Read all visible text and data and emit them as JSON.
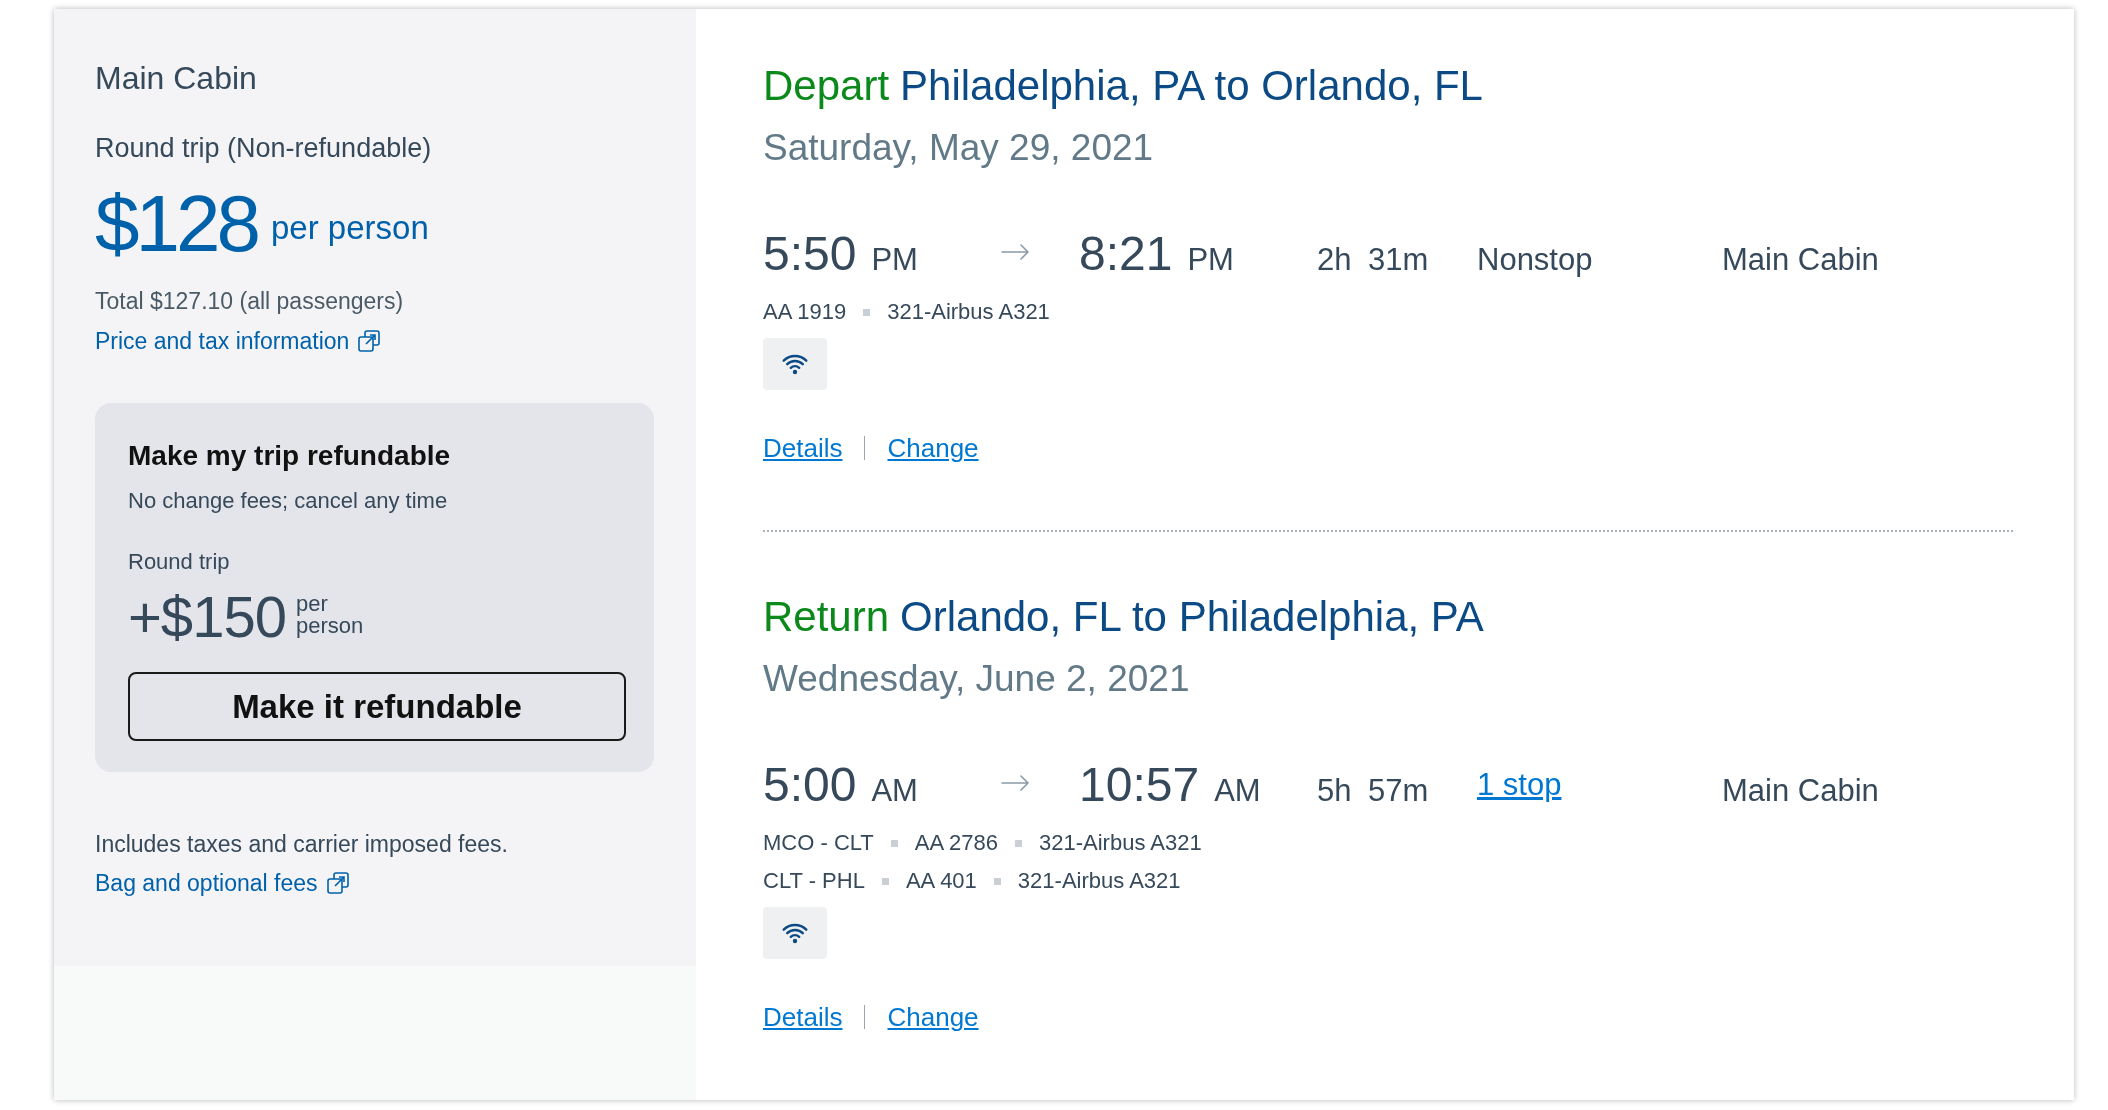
{
  "fare_panel": {
    "cabin": "Main Cabin",
    "fare_type": "Round trip (Non-refundable)",
    "price": "$128",
    "price_unit": "per person",
    "total": "Total $127.10 (all passengers)",
    "price_link": "Price and tax information"
  },
  "refund_offer": {
    "title": "Make my trip refundable",
    "subtitle": "No change fees; cancel any time",
    "trip_label": "Round trip",
    "price": "+$150",
    "price_unit": "per person",
    "button": "Make it refundable"
  },
  "fees": {
    "note": "Includes taxes and carrier imposed fees.",
    "link": "Bag and optional fees"
  },
  "flights": [
    {
      "direction": "Depart",
      "route": "Philadelphia, PA to Orlando, FL",
      "date": "Saturday, May 29, 2021",
      "departure": {
        "time": "5:50",
        "period": "PM"
      },
      "arrival": {
        "time": "8:21",
        "period": "PM"
      },
      "duration": "2h 31m",
      "stops": {
        "label": "Nonstop",
        "kind": "text"
      },
      "cabin": "Main Cabin",
      "segments": [
        [
          "AA 1919",
          "321-Airbus A321"
        ]
      ],
      "wifi": true,
      "links": [
        "Details",
        "Change"
      ]
    },
    {
      "direction": "Return",
      "route": "Orlando, FL to Philadelphia, PA",
      "date": "Wednesday, June 2, 2021",
      "departure": {
        "time": "5:00",
        "period": "AM"
      },
      "arrival": {
        "time": "10:57",
        "period": "AM"
      },
      "duration": "5h 57m",
      "stops": {
        "label": "1 stop",
        "kind": "link"
      },
      "cabin": "Main Cabin",
      "segments": [
        [
          "MCO - CLT",
          "AA 2786",
          "321-Airbus A321"
        ],
        [
          "CLT - PHL",
          "AA 401",
          "321-Airbus A321"
        ]
      ],
      "wifi": true,
      "links": [
        "Details",
        "Change"
      ]
    }
  ]
}
